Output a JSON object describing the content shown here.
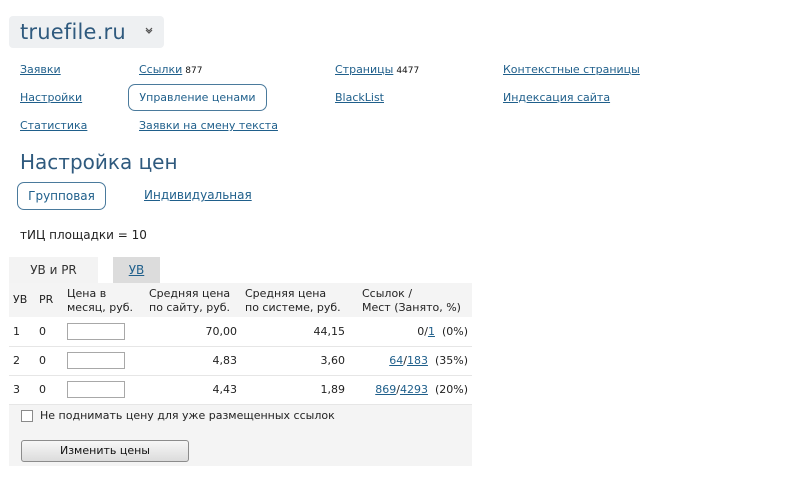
{
  "site": {
    "name": "truefile.ru"
  },
  "nav": {
    "orders": "Заявки",
    "links": "Ссылки",
    "links_count": "877",
    "pages": "Страницы",
    "pages_count": "4477",
    "context_pages": "Контекстные страницы",
    "settings": "Настройки",
    "price_mgmt": "Управление ценами",
    "blacklist": "BlackList",
    "indexing": "Индексация сайта",
    "stats": "Статистика",
    "text_change": "Заявки на смену текста"
  },
  "page": {
    "title": "Настройка цен",
    "mode_group": "Групповая",
    "mode_individual": "Индивидуальная",
    "tic_info": "тИЦ площадки = 10"
  },
  "tabs": {
    "uv_pr": "УВ и PR",
    "uv": "УВ"
  },
  "table": {
    "headers": {
      "uv": "УВ",
      "pr": "PR",
      "price_l1": "Цена в",
      "price_l2": "месяц, руб.",
      "avg_site_l1": "Средняя цена",
      "avg_site_l2": "по сайту, руб.",
      "avg_sys_l1": "Средняя цена",
      "avg_sys_l2": "по системе, руб.",
      "occ_l1": "Ссылок /",
      "occ_l2": "Мест (Занято, %)"
    },
    "rows": [
      {
        "uv": "1",
        "pr": "0",
        "price": "",
        "avg_site": "70,00",
        "avg_sys": "44,15",
        "links": "0",
        "places": "1",
        "pct": "(0%)"
      },
      {
        "uv": "2",
        "pr": "0",
        "price": "",
        "avg_site": "4,83",
        "avg_sys": "3,60",
        "links": "64",
        "places": "183",
        "pct": "(35%)"
      },
      {
        "uv": "3",
        "pr": "0",
        "price": "",
        "avg_site": "4,43",
        "avg_sys": "1,89",
        "links": "869",
        "places": "4293",
        "pct": "(20%)"
      }
    ]
  },
  "form": {
    "keep_price_label": "Не поднимать цену для уже размещенных ссылок",
    "keep_price_checked": false,
    "submit": "Изменить цены"
  }
}
